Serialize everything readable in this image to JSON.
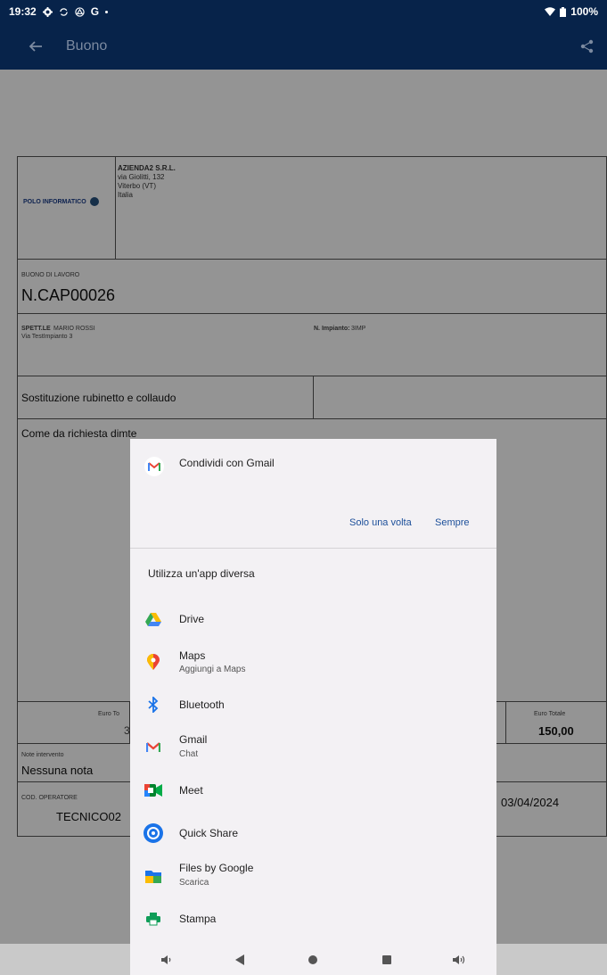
{
  "status_bar": {
    "time": "19:32",
    "letter": "G",
    "battery": "100%"
  },
  "app_bar": {
    "title": "Buono"
  },
  "document": {
    "company": {
      "name": "AZIENDA2 S.R.L.",
      "address": "via Giolitti, 132",
      "city": "Viterbo (VT)",
      "country": "Italia"
    },
    "logo_text": "POLO INFORMATICO",
    "voucher_label": "BUONO DI LAVORO",
    "voucher_number": "N.CAP00026",
    "customer_label": "SPETT.LE",
    "customer_name": "MARIO ROSSI",
    "customer_address": "Via TestImpianto 3",
    "plant_label": "N. Impianto:",
    "plant_value": "3IMP",
    "work_title": "Sostituzione rubinetto e collaudo",
    "work_desc": "Come da richiesta dimte",
    "total_label_left": "Euro To",
    "total_value_left": "3",
    "total_label_right": "Euro Totale",
    "total_value_right": "150,00",
    "notes_label": "Note intervento",
    "notes_value": "Nessuna nota",
    "operator_label": "COD. OPERATORE",
    "operator_value": "TECNICO02",
    "date_value": "03/04/2024"
  },
  "share_sheet": {
    "title": "Condividi con Gmail",
    "once_label": "Solo una volta",
    "always_label": "Sempre",
    "other_app_title": "Utilizza un'app diversa",
    "apps": [
      {
        "name": "Drive",
        "sub": "",
        "icon": "drive-icon"
      },
      {
        "name": "Maps",
        "sub": "Aggiungi a Maps",
        "icon": "maps-icon"
      },
      {
        "name": "Bluetooth",
        "sub": "",
        "icon": "bluetooth-icon"
      },
      {
        "name": "Gmail",
        "sub": "Chat",
        "icon": "gmail-icon"
      },
      {
        "name": "Meet",
        "sub": "",
        "icon": "meet-icon"
      },
      {
        "name": "Quick Share",
        "sub": "",
        "icon": "quick-share-icon"
      },
      {
        "name": "Files by Google",
        "sub": "Scarica",
        "icon": "files-icon"
      },
      {
        "name": "Stampa",
        "sub": "",
        "icon": "print-icon"
      }
    ]
  },
  "nav_bar": {
    "buttons": [
      "volume-down-icon",
      "back-icon",
      "home-icon",
      "recents-icon",
      "volume-up-icon"
    ]
  }
}
